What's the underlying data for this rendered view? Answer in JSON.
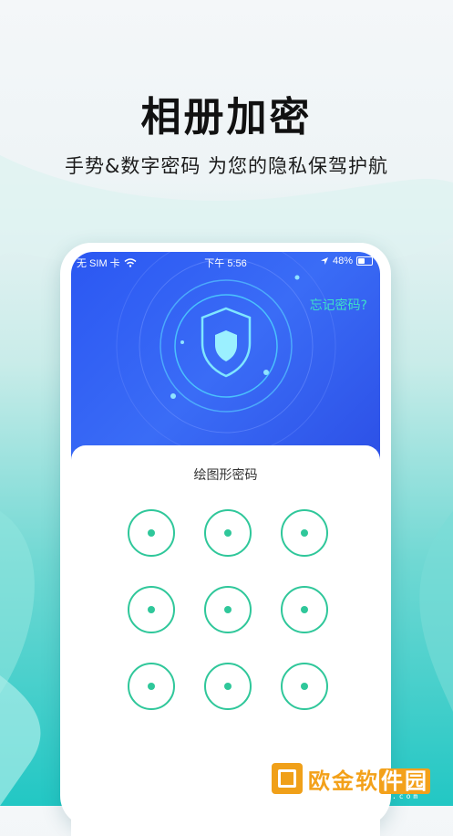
{
  "headline": "相册加密",
  "subline": "手势&数字密码 为您的隐私保驾护航",
  "status_bar": {
    "carrier": "无 SIM 卡",
    "time": "下午 5:56",
    "battery": "48%",
    "battery_level": 0.48
  },
  "hero": {
    "forgot_password": "忘记密码?"
  },
  "panel": {
    "title": "绘图形密码",
    "pattern_nodes": [
      1,
      2,
      3,
      4,
      5,
      6,
      7,
      8,
      9
    ]
  },
  "watermark": {
    "brand_a": "欧金软",
    "brand_b": "件园",
    "url": "www.apoujin.com"
  },
  "colors": {
    "accent_green": "#2fc79a",
    "hero_blue": "#2b57f2",
    "forgot_text": "#3ee0c8",
    "logo_orange": "#f3a11a"
  },
  "icons": [
    "wifi-icon",
    "location-arrow-icon",
    "battery-icon",
    "shield-icon",
    "logo-mark-icon"
  ]
}
